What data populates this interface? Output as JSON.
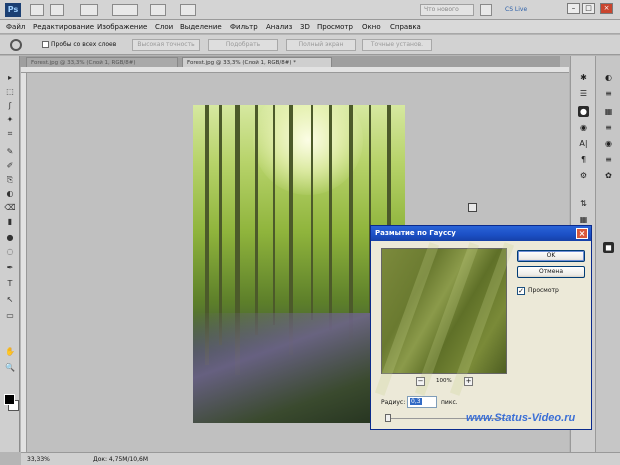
{
  "appbar": {
    "logo": "Ps",
    "workspace_label": "Что нового",
    "cslive_label": "CS Live",
    "min_label": "–",
    "max_label": "□",
    "close_label": "×"
  },
  "menu": [
    "Файл",
    "Редактирование",
    "Изображение",
    "Слои",
    "Выделение",
    "Фильтр",
    "Анализ",
    "3D",
    "Просмотр",
    "Окно",
    "Справка"
  ],
  "options": {
    "sample_all_label": "Пробы со всех слоев",
    "buttons": [
      "Высокая точность",
      "Подобрать",
      "Полный экран",
      "Точные установ."
    ]
  },
  "tabs": [
    {
      "label": "Forest.jpg @ 33,3% (Слой 1, RGB/8#)",
      "active": false
    },
    {
      "label": "Forest.jpg @ 33,3% (Слой 1, RGB/8#) *",
      "active": true
    }
  ],
  "toolbar": [
    "▸",
    "⬚",
    "ʃ",
    "✦",
    "⌗",
    "✎",
    "✐",
    "⎘",
    "◐",
    "⌫",
    "▮",
    "●",
    "◌",
    "✒",
    "T",
    "↖",
    "▭",
    "✋",
    "🔍"
  ],
  "panels_left": [
    "✱",
    "☰",
    "●",
    "◉",
    "A|",
    "¶",
    "⚙",
    "⇅",
    "▦"
  ],
  "panels_right": [
    "◐",
    "≡",
    "▦",
    "≡",
    "◉",
    "≡",
    "✿",
    "◼"
  ],
  "status": {
    "zoom": "33,33%",
    "doc": "Док: 4,75M/10,6M"
  },
  "dialog": {
    "title": "Размытие по Гауссу",
    "close_label": "×",
    "ok_label": "OK",
    "cancel_label": "Отмена",
    "preview_label": "Просмотр",
    "preview_checked": true,
    "zoom_minus": "−",
    "zoom_plus": "+",
    "zoom_pct": "100%",
    "radius_label": "Радиус:",
    "radius_value": "0,3",
    "radius_unit": "пикс."
  },
  "watermark": "www.Status-Video.ru"
}
